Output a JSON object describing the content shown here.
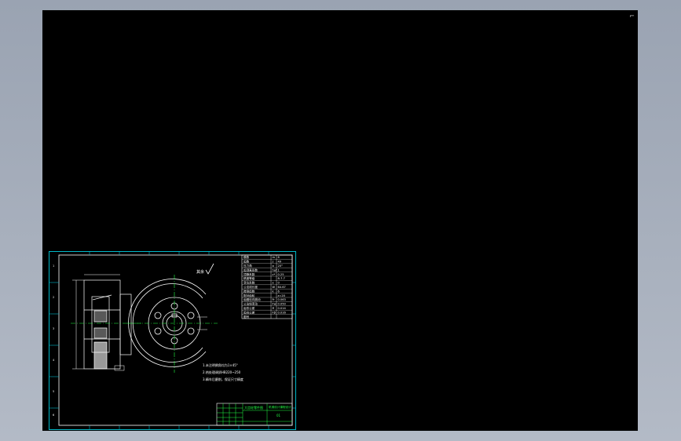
{
  "viewport": {
    "background": "#000000",
    "workspace_background": "#a5adba",
    "corner_mark": "⌐"
  },
  "sheet": {
    "frame_color": "#00b8c8",
    "line_color": "#ffffff",
    "grid_numbers": [
      "1",
      "2",
      "3",
      "4",
      "5",
      "6",
      "7",
      "8"
    ]
  },
  "drawing": {
    "roughness_mark": "其余",
    "note_lines": [
      "1.未注明倒角均为1×45°",
      "2.热处理调质HB220~250",
      "3.精车后磨削，保证尺寸精度"
    ],
    "param_table": {
      "rows": [
        [
          "模数",
          "m",
          "6"
        ],
        [
          "齿数",
          "z",
          "49"
        ],
        [
          "压力角",
          "α",
          "20°"
        ],
        [
          "齿顶高系数",
          "ha*",
          "1"
        ],
        [
          "顶隙系数",
          "c*",
          "0.25"
        ],
        [
          "精度等级",
          "",
          "8-7-7"
        ],
        [
          "变位系数",
          "x",
          "0"
        ],
        [
          "公法线长度",
          "W",
          "64.67"
        ],
        [
          "跨测齿数",
          "k",
          "6"
        ],
        [
          "配对齿轮",
          "",
          "z=20"
        ],
        [
          "齿圈径向跳动",
          "Fr",
          "0.063"
        ],
        [
          "公法线变动",
          "Fw",
          "0.050"
        ],
        [
          "齿形公差",
          "ff",
          "0.014"
        ],
        [
          "齿向公差",
          "Fβ",
          "0.016"
        ],
        [
          "图号",
          "",
          ""
        ]
      ]
    },
    "title_block": {
      "accent_color": "#22ff44",
      "name": "大齿轮零件图",
      "school": "机械设计课程设计",
      "drawing_no": "01"
    }
  }
}
